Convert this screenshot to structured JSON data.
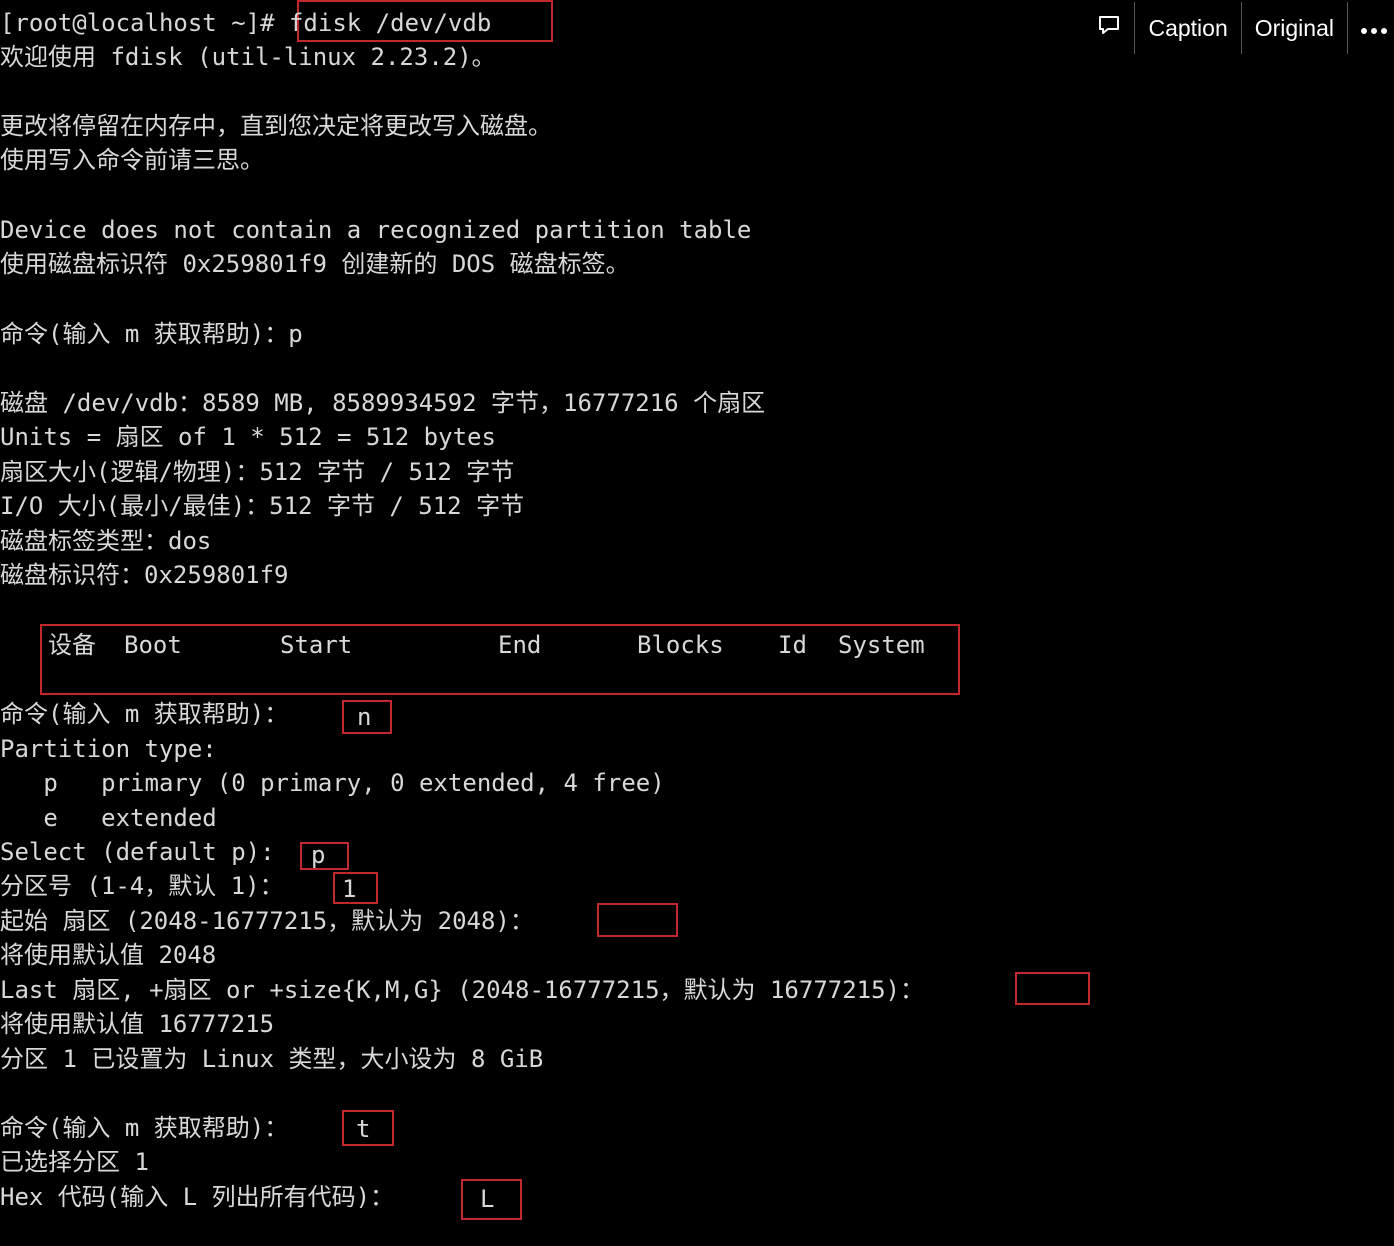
{
  "toolbar": {
    "caption_label": "Caption",
    "original_label": "Original",
    "comment_icon": "speech-bubble-icon",
    "more_icon": "ellipsis-icon"
  },
  "terminal": {
    "lines": [
      "[root@localhost ~]# fdisk /dev/vdb",
      "欢迎使用 fdisk (util-linux 2.23.2)。",
      "更改将停留在内存中，直到您决定将更改写入磁盘。",
      "使用写入命令前请三思。",
      "Device does not contain a recognized partition table",
      "使用磁盘标识符 0x259801f9 创建新的 DOS 磁盘标签。",
      "命令(输入 m 获取帮助)：p",
      "磁盘 /dev/vdb：8589 MB, 8589934592 字节，16777216 个扇区",
      "Units = 扇区 of 1 * 512 = 512 bytes",
      "扇区大小(逻辑/物理)：512 字节 / 512 字节",
      "I/O 大小(最小/最佳)：512 字节 / 512 字节",
      "磁盘标签类型：dos",
      "磁盘标识符：0x259801f9",
      "命令(输入 m 获取帮助)：",
      "Partition type:",
      "   p   primary (0 primary, 0 extended, 4 free)",
      "   e   extended",
      "Select (default p):",
      "分区号 (1-4，默认 1)：",
      "起始 扇区 (2048-16777215，默认为 2048)：",
      "将使用默认值 2048",
      "Last 扇区, +扇区 or +size{K,M,G} (2048-16777215，默认为 16777215)：",
      "将使用默认值 16777215",
      "分区 1 已设置为 Linux 类型，大小设为 8 GiB",
      "命令(输入 m 获取帮助)：",
      "已选择分区 1",
      "Hex 代码(输入 L 列出所有代码)："
    ],
    "table_header": {
      "device": "设备",
      "boot": "Boot",
      "start": "Start",
      "end": "End",
      "blocks": "Blocks",
      "id": "Id",
      "system": "System"
    },
    "inputs": {
      "cmd_new": "n",
      "select_type": "p",
      "partition_number": "1",
      "first_sector": "",
      "last_sector": "",
      "cmd_type": "t",
      "hex_code": "L"
    }
  },
  "colors": {
    "background": "#000000",
    "text": "#d8d8d8",
    "highlight_border": "#c0282e"
  }
}
